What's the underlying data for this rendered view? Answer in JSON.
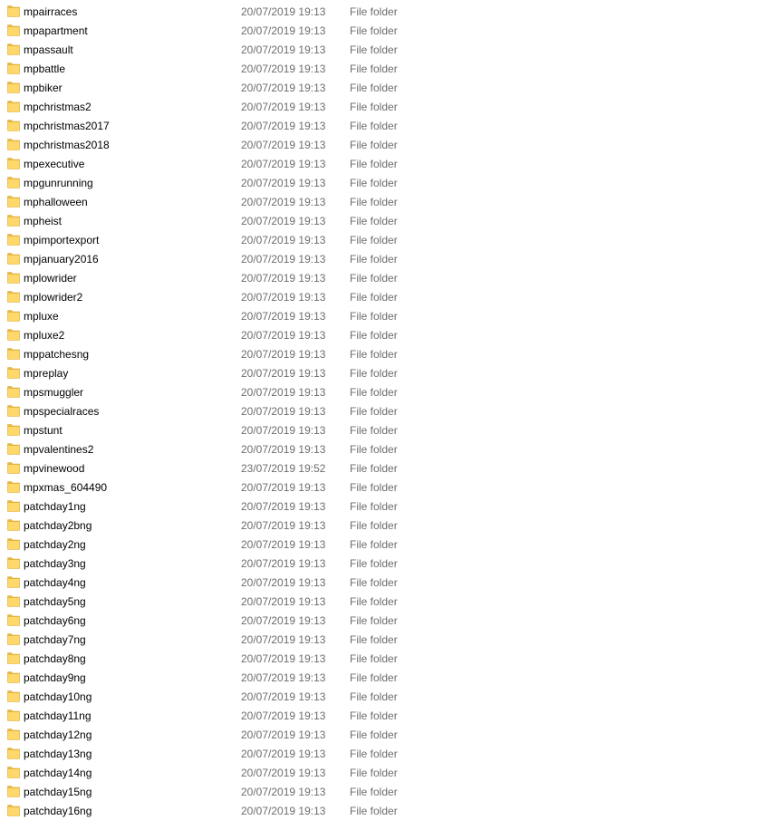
{
  "colors": {
    "folder_body": "#ffd86b",
    "folder_tab": "#e8b943",
    "folder_edge": "#d9a730",
    "secondary_text": "#6d6d6d",
    "hover": "#e5f3ff"
  },
  "icon": "folder-icon",
  "files": [
    {
      "name": "mpairraces",
      "date": "20/07/2019 19:13",
      "type": "File folder"
    },
    {
      "name": "mpapartment",
      "date": "20/07/2019 19:13",
      "type": "File folder"
    },
    {
      "name": "mpassault",
      "date": "20/07/2019 19:13",
      "type": "File folder"
    },
    {
      "name": "mpbattle",
      "date": "20/07/2019 19:13",
      "type": "File folder"
    },
    {
      "name": "mpbiker",
      "date": "20/07/2019 19:13",
      "type": "File folder"
    },
    {
      "name": "mpchristmas2",
      "date": "20/07/2019 19:13",
      "type": "File folder"
    },
    {
      "name": "mpchristmas2017",
      "date": "20/07/2019 19:13",
      "type": "File folder"
    },
    {
      "name": "mpchristmas2018",
      "date": "20/07/2019 19:13",
      "type": "File folder"
    },
    {
      "name": "mpexecutive",
      "date": "20/07/2019 19:13",
      "type": "File folder"
    },
    {
      "name": "mpgunrunning",
      "date": "20/07/2019 19:13",
      "type": "File folder"
    },
    {
      "name": "mphalloween",
      "date": "20/07/2019 19:13",
      "type": "File folder"
    },
    {
      "name": "mpheist",
      "date": "20/07/2019 19:13",
      "type": "File folder"
    },
    {
      "name": "mpimportexport",
      "date": "20/07/2019 19:13",
      "type": "File folder"
    },
    {
      "name": "mpjanuary2016",
      "date": "20/07/2019 19:13",
      "type": "File folder"
    },
    {
      "name": "mplowrider",
      "date": "20/07/2019 19:13",
      "type": "File folder"
    },
    {
      "name": "mplowrider2",
      "date": "20/07/2019 19:13",
      "type": "File folder"
    },
    {
      "name": "mpluxe",
      "date": "20/07/2019 19:13",
      "type": "File folder"
    },
    {
      "name": "mpluxe2",
      "date": "20/07/2019 19:13",
      "type": "File folder"
    },
    {
      "name": "mppatchesng",
      "date": "20/07/2019 19:13",
      "type": "File folder"
    },
    {
      "name": "mpreplay",
      "date": "20/07/2019 19:13",
      "type": "File folder"
    },
    {
      "name": "mpsmuggler",
      "date": "20/07/2019 19:13",
      "type": "File folder"
    },
    {
      "name": "mpspecialraces",
      "date": "20/07/2019 19:13",
      "type": "File folder"
    },
    {
      "name": "mpstunt",
      "date": "20/07/2019 19:13",
      "type": "File folder"
    },
    {
      "name": "mpvalentines2",
      "date": "20/07/2019 19:13",
      "type": "File folder"
    },
    {
      "name": "mpvinewood",
      "date": "23/07/2019 19:52",
      "type": "File folder"
    },
    {
      "name": "mpxmas_604490",
      "date": "20/07/2019 19:13",
      "type": "File folder"
    },
    {
      "name": "patchday1ng",
      "date": "20/07/2019 19:13",
      "type": "File folder"
    },
    {
      "name": "patchday2bng",
      "date": "20/07/2019 19:13",
      "type": "File folder"
    },
    {
      "name": "patchday2ng",
      "date": "20/07/2019 19:13",
      "type": "File folder"
    },
    {
      "name": "patchday3ng",
      "date": "20/07/2019 19:13",
      "type": "File folder"
    },
    {
      "name": "patchday4ng",
      "date": "20/07/2019 19:13",
      "type": "File folder"
    },
    {
      "name": "patchday5ng",
      "date": "20/07/2019 19:13",
      "type": "File folder"
    },
    {
      "name": "patchday6ng",
      "date": "20/07/2019 19:13",
      "type": "File folder"
    },
    {
      "name": "patchday7ng",
      "date": "20/07/2019 19:13",
      "type": "File folder"
    },
    {
      "name": "patchday8ng",
      "date": "20/07/2019 19:13",
      "type": "File folder"
    },
    {
      "name": "patchday9ng",
      "date": "20/07/2019 19:13",
      "type": "File folder"
    },
    {
      "name": "patchday10ng",
      "date": "20/07/2019 19:13",
      "type": "File folder"
    },
    {
      "name": "patchday11ng",
      "date": "20/07/2019 19:13",
      "type": "File folder"
    },
    {
      "name": "patchday12ng",
      "date": "20/07/2019 19:13",
      "type": "File folder"
    },
    {
      "name": "patchday13ng",
      "date": "20/07/2019 19:13",
      "type": "File folder"
    },
    {
      "name": "patchday14ng",
      "date": "20/07/2019 19:13",
      "type": "File folder"
    },
    {
      "name": "patchday15ng",
      "date": "20/07/2019 19:13",
      "type": "File folder"
    },
    {
      "name": "patchday16ng",
      "date": "20/07/2019 19:13",
      "type": "File folder"
    }
  ]
}
